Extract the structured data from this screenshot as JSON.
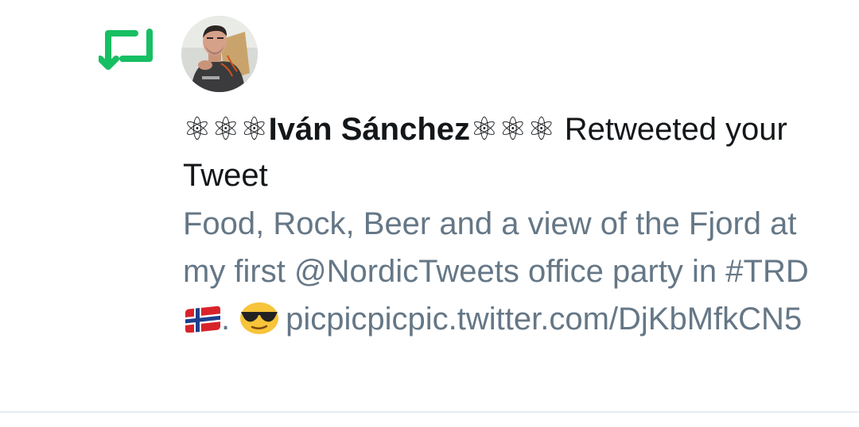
{
  "notification": {
    "icon": "retweet-icon",
    "accent_color": "#17bf63",
    "avatar_alt": "profile photo",
    "user_name": "⚛⚛⚛Iván Sánchez⚛⚛⚛",
    "action_text": " Retweeted your Tweet",
    "tweet": {
      "text_before_flag": "Food, Rock, Beer and a view of the Fjord at my first @NordicTweets office party in #TRD",
      "after_flag": ".",
      "emoji_flag": "norway-flag-icon",
      "emoji_face": "sunglasses-face-icon",
      "link_text": "picpicpicpic.twitter.com/DjKbMfkCN5"
    }
  },
  "colors": {
    "primary_text": "#14171a",
    "secondary_text": "#657786",
    "divider": "#e6ecf0"
  }
}
